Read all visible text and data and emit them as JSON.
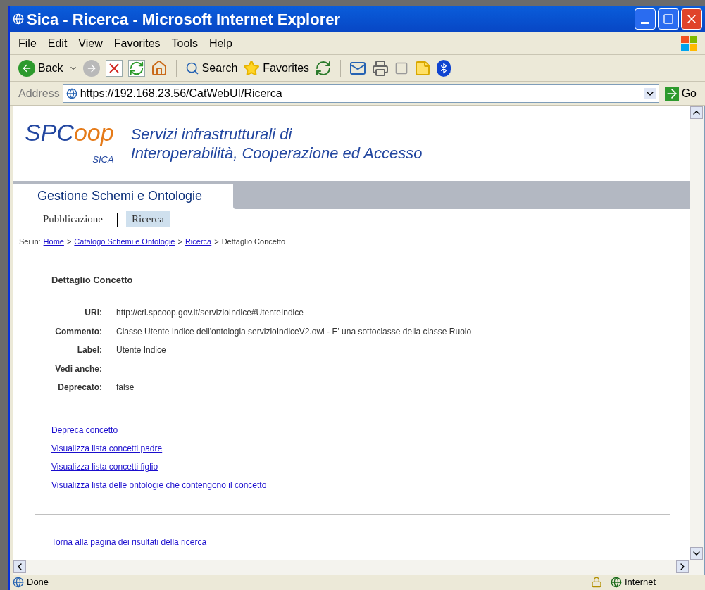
{
  "window": {
    "title": "Sica - Ricerca - Microsoft Internet Explorer"
  },
  "menu": [
    "File",
    "Edit",
    "View",
    "Favorites",
    "Tools",
    "Help"
  ],
  "toolbar": {
    "back": "Back",
    "search": "Search",
    "favorites": "Favorites"
  },
  "address": {
    "label": "Address",
    "url": "https://192.168.23.56/CatWebUI/Ricerca",
    "go": "Go"
  },
  "banner": {
    "logo_main": "SPC",
    "logo_accent": "oop",
    "logo_sub": "SICA",
    "line_1": "Servizi infrastrutturali di",
    "line_2": "Interoperabilità, Cooperazione ed Accesso"
  },
  "section_title": "Gestione Schemi e Ontologie",
  "tabs": [
    {
      "label": "Pubblicazione",
      "selected": false
    },
    {
      "label": "Ricerca",
      "selected": true
    }
  ],
  "breadcrumb": {
    "prefix": "Sei in:",
    "items": [
      {
        "text": "Home",
        "kind": "link"
      },
      {
        "text": ">",
        "kind": "separator"
      },
      {
        "text": "Catalogo Schemi e Ontologie",
        "kind": "link"
      },
      {
        "text": ">",
        "kind": "separator"
      },
      {
        "text": "Ricerca",
        "kind": "link"
      },
      {
        "text": ">",
        "kind": "separator"
      },
      {
        "text": "Dettaglio Concetto",
        "kind": "current"
      }
    ]
  },
  "heading": "Dettaglio Concetto",
  "fields": [
    {
      "label": "URI:",
      "value": "http://cri.spcoop.gov.it/servizioIndice#UtenteIndice"
    },
    {
      "label": "Commento:",
      "value": "Classe Utente Indice dell'ontologia servizioIndiceV2.owl - E' una sottoclasse della classe Ruolo"
    },
    {
      "label": "Label:",
      "value": "Utente Indice"
    },
    {
      "label": "Vedi anche:"
    },
    {
      "label": "Deprecato:",
      "value": "false"
    }
  ],
  "links": [
    "Depreca concetto",
    "Visualizza lista concetti padre",
    "Visualizza lista concetti figlio",
    "Visualizza lista delle ontologie che contengono il concetto"
  ],
  "back_link": "Torna alla pagina dei risultati della ricerca",
  "status_bar": {
    "text": "Done",
    "zone": "Internet"
  }
}
